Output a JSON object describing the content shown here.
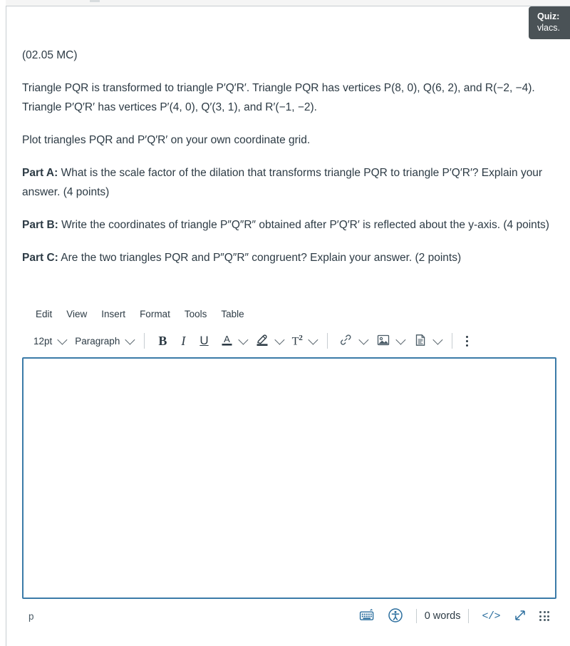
{
  "tooltip": {
    "title": "Quiz:",
    "subtitle": "vlacs."
  },
  "question": {
    "code": "(02.05 MC)",
    "intro": "Triangle PQR is transformed to triangle P′Q′R′. Triangle PQR has vertices P(8, 0), Q(6, 2), and R(−2, −4). Triangle P′Q′R′ has vertices P′(4, 0), Q′(3, 1), and R′(−1, −2).",
    "instruction": "Plot triangles PQR and P′Q′R′ on your own coordinate grid.",
    "part_a_label": "Part A:",
    "part_a_text": "What is the scale factor of the dilation that transforms triangle PQR to triangle P′Q′R′? Explain your answer. (4 points)",
    "part_b_label": "Part B:",
    "part_b_text": "Write the coordinates of triangle P″Q″R″ obtained after P′Q′R′ is reflected about the y-axis. (4 points)",
    "part_c_label": "Part C:",
    "part_c_text": "Are the two triangles PQR and P″Q″R″ congruent? Explain your answer. (2 points)"
  },
  "editor": {
    "menubar": [
      {
        "label": "Edit",
        "name": "menu-edit"
      },
      {
        "label": "View",
        "name": "menu-view"
      },
      {
        "label": "Insert",
        "name": "menu-insert"
      },
      {
        "label": "Format",
        "name": "menu-format"
      },
      {
        "label": "Tools",
        "name": "menu-tools"
      },
      {
        "label": "Table",
        "name": "menu-table"
      }
    ],
    "toolbar": {
      "font_size": "12pt",
      "block_format": "Paragraph",
      "bold": "B",
      "italic": "I",
      "underline": "U",
      "text_color_glyph": "A",
      "superscript_glyph": "T",
      "superscript_exponent": "2",
      "icons": {
        "text_color": "text-color-icon",
        "highlight": "highlighter-icon",
        "superscript": "superscript-icon",
        "link": "link-icon",
        "image": "image-icon",
        "document": "document-icon",
        "more": "kebab-menu-icon"
      }
    },
    "content": "",
    "status": {
      "element_path": "p",
      "word_count": "0 words",
      "keyboard_icon": "on-screen-keyboard-icon",
      "accessibility_icon": "accessibility-checker-icon",
      "html_editor_glyph": "</>",
      "fullscreen_icon": "expand-diagonal-icon",
      "resize_handle_icon": "resize-grip-icon"
    }
  },
  "colors": {
    "accent_border": "#3b7ba8",
    "link_blue": "#2b6e9e",
    "text": "#2d3b45",
    "tooltip_bg": "#4a5256",
    "divider": "#c7cdd1"
  }
}
